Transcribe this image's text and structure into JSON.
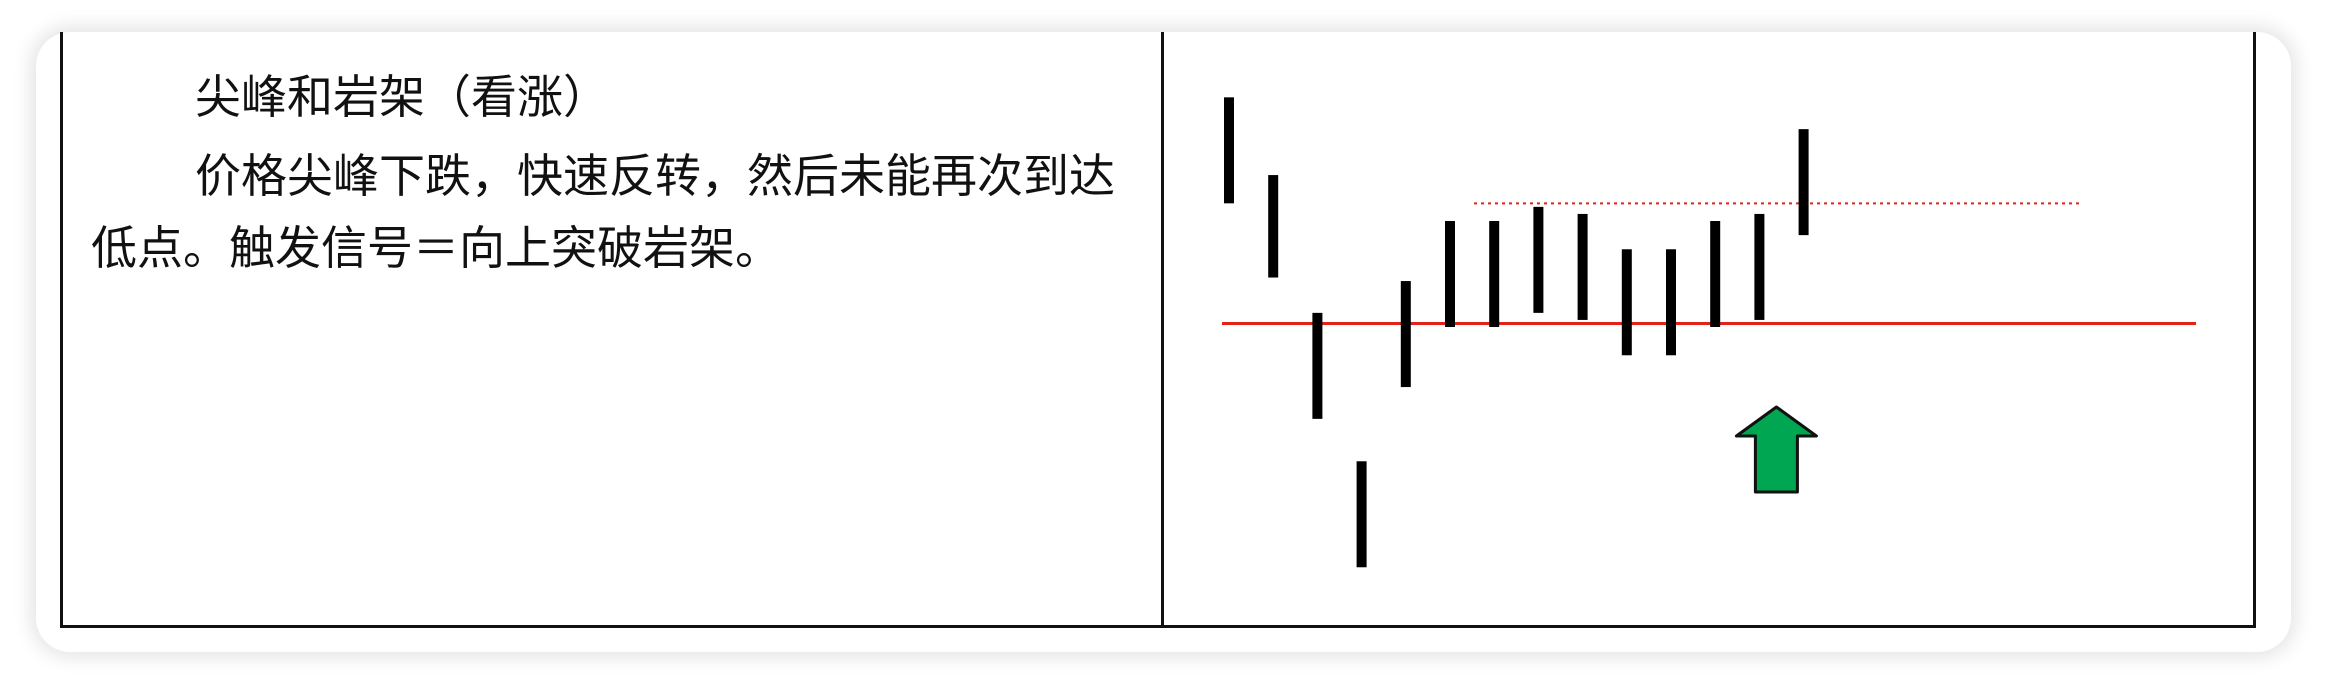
{
  "text_cell": {
    "heading": "尖峰和岩架（看涨）",
    "body": "价格尖峰下跌，快速反转，然后未能再次到达低点。触发信号＝向上突破岩架。"
  },
  "chart_data": {
    "type": "bar",
    "ohlc_bars": [
      {
        "high": 8.5,
        "low": 5.5
      },
      {
        "high": 6.3,
        "low": 3.4
      },
      {
        "high": 2.4,
        "low": -0.6
      },
      {
        "high": -1.8,
        "low": -4.8
      },
      {
        "high": 3.3,
        "low": 0.3
      },
      {
        "high": 5.0,
        "low": 2.0
      },
      {
        "high": 5.0,
        "low": 2.0
      },
      {
        "high": 5.4,
        "low": 2.4
      },
      {
        "high": 5.2,
        "low": 2.2
      },
      {
        "high": 4.2,
        "low": 1.2
      },
      {
        "high": 4.2,
        "low": 1.2
      },
      {
        "high": 5.0,
        "low": 2.0
      },
      {
        "high": 5.2,
        "low": 2.2
      },
      {
        "high": 7.6,
        "low": 4.6
      }
    ],
    "support_level": 2.1,
    "ledge_top_level": 5.5,
    "arrow": {
      "at_bar": 12,
      "direction": "up"
    },
    "colors": {
      "bars": "#000000",
      "support_line": "#e2231a",
      "ledge_line": "#e2231a",
      "arrow_fill": "#00a651",
      "arrow_stroke": "#111111"
    },
    "ylim": [
      -5.5,
      9.5
    ],
    "grid": false
  }
}
